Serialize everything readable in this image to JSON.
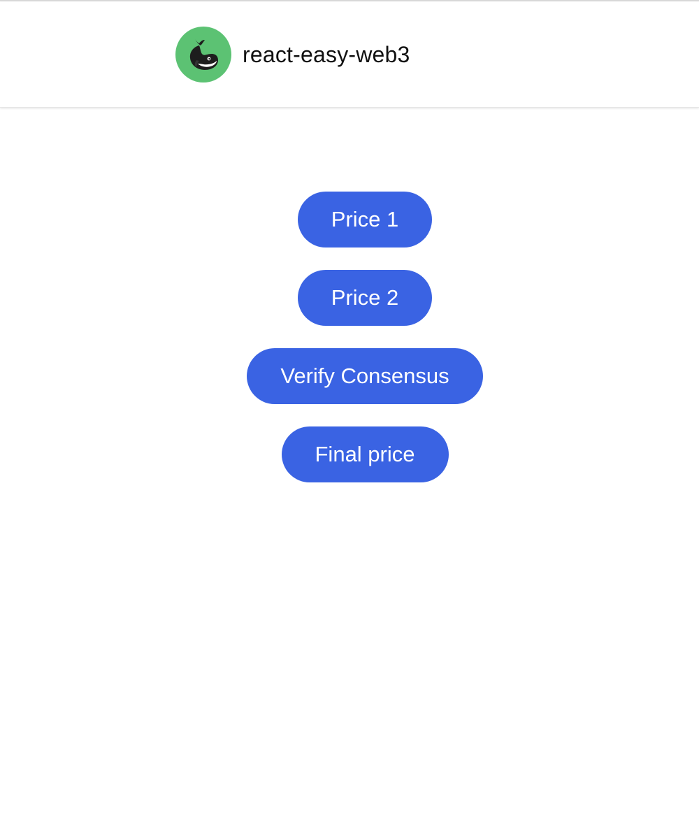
{
  "header": {
    "logo_icon": "whale-icon",
    "title": "react-easy-web3"
  },
  "colors": {
    "logo_bg": "#5cc273",
    "button_bg": "#3a63e3",
    "button_text": "#ffffff"
  },
  "buttons": [
    {
      "label": "Price 1"
    },
    {
      "label": "Price 2"
    },
    {
      "label": "Verify Consensus"
    },
    {
      "label": "Final price"
    }
  ]
}
